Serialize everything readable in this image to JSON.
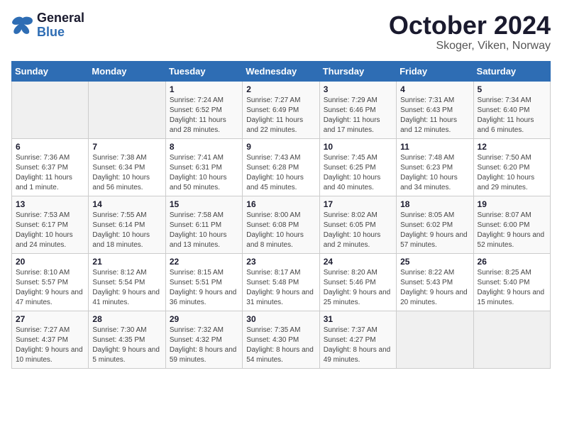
{
  "header": {
    "logo_general": "General",
    "logo_blue": "Blue",
    "title": "October 2024",
    "location": "Skoger, Viken, Norway"
  },
  "days_of_week": [
    "Sunday",
    "Monday",
    "Tuesday",
    "Wednesday",
    "Thursday",
    "Friday",
    "Saturday"
  ],
  "weeks": [
    [
      {
        "day": "",
        "info": ""
      },
      {
        "day": "",
        "info": ""
      },
      {
        "day": "1",
        "info": "Sunrise: 7:24 AM\nSunset: 6:52 PM\nDaylight: 11 hours and 28 minutes."
      },
      {
        "day": "2",
        "info": "Sunrise: 7:27 AM\nSunset: 6:49 PM\nDaylight: 11 hours and 22 minutes."
      },
      {
        "day": "3",
        "info": "Sunrise: 7:29 AM\nSunset: 6:46 PM\nDaylight: 11 hours and 17 minutes."
      },
      {
        "day": "4",
        "info": "Sunrise: 7:31 AM\nSunset: 6:43 PM\nDaylight: 11 hours and 12 minutes."
      },
      {
        "day": "5",
        "info": "Sunrise: 7:34 AM\nSunset: 6:40 PM\nDaylight: 11 hours and 6 minutes."
      }
    ],
    [
      {
        "day": "6",
        "info": "Sunrise: 7:36 AM\nSunset: 6:37 PM\nDaylight: 11 hours and 1 minute."
      },
      {
        "day": "7",
        "info": "Sunrise: 7:38 AM\nSunset: 6:34 PM\nDaylight: 10 hours and 56 minutes."
      },
      {
        "day": "8",
        "info": "Sunrise: 7:41 AM\nSunset: 6:31 PM\nDaylight: 10 hours and 50 minutes."
      },
      {
        "day": "9",
        "info": "Sunrise: 7:43 AM\nSunset: 6:28 PM\nDaylight: 10 hours and 45 minutes."
      },
      {
        "day": "10",
        "info": "Sunrise: 7:45 AM\nSunset: 6:25 PM\nDaylight: 10 hours and 40 minutes."
      },
      {
        "day": "11",
        "info": "Sunrise: 7:48 AM\nSunset: 6:23 PM\nDaylight: 10 hours and 34 minutes."
      },
      {
        "day": "12",
        "info": "Sunrise: 7:50 AM\nSunset: 6:20 PM\nDaylight: 10 hours and 29 minutes."
      }
    ],
    [
      {
        "day": "13",
        "info": "Sunrise: 7:53 AM\nSunset: 6:17 PM\nDaylight: 10 hours and 24 minutes."
      },
      {
        "day": "14",
        "info": "Sunrise: 7:55 AM\nSunset: 6:14 PM\nDaylight: 10 hours and 18 minutes."
      },
      {
        "day": "15",
        "info": "Sunrise: 7:58 AM\nSunset: 6:11 PM\nDaylight: 10 hours and 13 minutes."
      },
      {
        "day": "16",
        "info": "Sunrise: 8:00 AM\nSunset: 6:08 PM\nDaylight: 10 hours and 8 minutes."
      },
      {
        "day": "17",
        "info": "Sunrise: 8:02 AM\nSunset: 6:05 PM\nDaylight: 10 hours and 2 minutes."
      },
      {
        "day": "18",
        "info": "Sunrise: 8:05 AM\nSunset: 6:02 PM\nDaylight: 9 hours and 57 minutes."
      },
      {
        "day": "19",
        "info": "Sunrise: 8:07 AM\nSunset: 6:00 PM\nDaylight: 9 hours and 52 minutes."
      }
    ],
    [
      {
        "day": "20",
        "info": "Sunrise: 8:10 AM\nSunset: 5:57 PM\nDaylight: 9 hours and 47 minutes."
      },
      {
        "day": "21",
        "info": "Sunrise: 8:12 AM\nSunset: 5:54 PM\nDaylight: 9 hours and 41 minutes."
      },
      {
        "day": "22",
        "info": "Sunrise: 8:15 AM\nSunset: 5:51 PM\nDaylight: 9 hours and 36 minutes."
      },
      {
        "day": "23",
        "info": "Sunrise: 8:17 AM\nSunset: 5:48 PM\nDaylight: 9 hours and 31 minutes."
      },
      {
        "day": "24",
        "info": "Sunrise: 8:20 AM\nSunset: 5:46 PM\nDaylight: 9 hours and 25 minutes."
      },
      {
        "day": "25",
        "info": "Sunrise: 8:22 AM\nSunset: 5:43 PM\nDaylight: 9 hours and 20 minutes."
      },
      {
        "day": "26",
        "info": "Sunrise: 8:25 AM\nSunset: 5:40 PM\nDaylight: 9 hours and 15 minutes."
      }
    ],
    [
      {
        "day": "27",
        "info": "Sunrise: 7:27 AM\nSunset: 4:37 PM\nDaylight: 9 hours and 10 minutes."
      },
      {
        "day": "28",
        "info": "Sunrise: 7:30 AM\nSunset: 4:35 PM\nDaylight: 9 hours and 5 minutes."
      },
      {
        "day": "29",
        "info": "Sunrise: 7:32 AM\nSunset: 4:32 PM\nDaylight: 8 hours and 59 minutes."
      },
      {
        "day": "30",
        "info": "Sunrise: 7:35 AM\nSunset: 4:30 PM\nDaylight: 8 hours and 54 minutes."
      },
      {
        "day": "31",
        "info": "Sunrise: 7:37 AM\nSunset: 4:27 PM\nDaylight: 8 hours and 49 minutes."
      },
      {
        "day": "",
        "info": ""
      },
      {
        "day": "",
        "info": ""
      }
    ]
  ]
}
